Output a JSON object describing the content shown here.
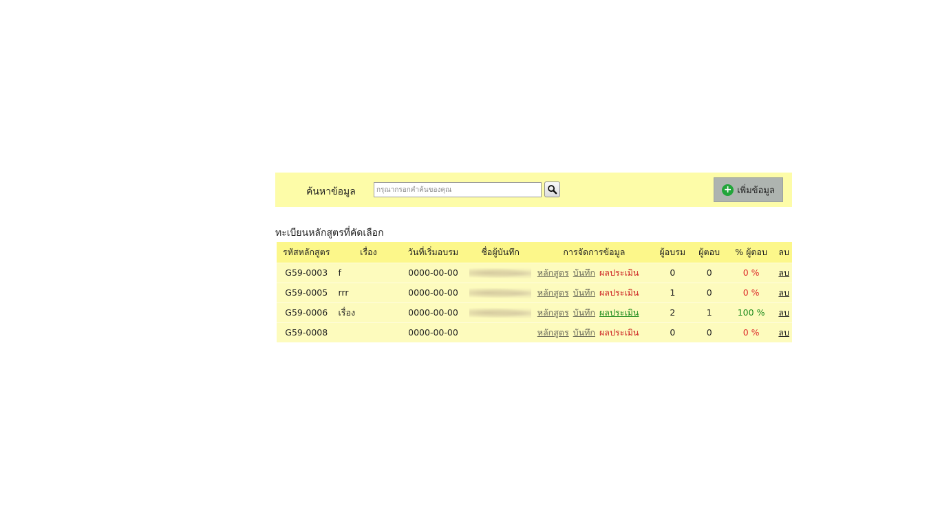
{
  "search": {
    "label": "ค้นหาข้อมูล",
    "placeholder": "กรุณากรอกคำค้นของคุณ",
    "value": ""
  },
  "add_button": {
    "label": "เพิ่มข้อมูล"
  },
  "section_title": "ทะเบียนหลักสูตรที่คัดเลือก",
  "table": {
    "headers": [
      "รหัสหลักสูตร",
      "เรื่อง",
      "วันที่เริ่มอบรม",
      "ชื่อผู้บันทึก",
      "การจัดการข้อมูล",
      "ผู้อบรม",
      "ผู้ตอบ",
      "% ผู้ตอบ",
      "ลบ"
    ],
    "actions": {
      "course": "หลักสูตร",
      "record": "บันทึก",
      "evaluate": "ผลประเมิน",
      "delete": "ลบ"
    },
    "rows": [
      {
        "code": "G59-0003",
        "subject": "f",
        "start_date": "0000-00-00",
        "trainees": "0",
        "responders": "0",
        "percent": "0 %"
      },
      {
        "code": "G59-0005",
        "subject": "rrr",
        "start_date": "0000-00-00",
        "trainees": "1",
        "responders": "0",
        "percent": "0 %"
      },
      {
        "code": "G59-0006",
        "subject": "เรื่อง",
        "start_date": "0000-00-00",
        "trainees": "2",
        "responders": "1",
        "percent": "100 %"
      },
      {
        "code": "G59-0008",
        "subject": "",
        "start_date": "0000-00-00",
        "trainees": "0",
        "responders": "0",
        "percent": "0 %"
      }
    ]
  },
  "colors": {
    "header_bg": "#fcf78a",
    "row_bg": "#fdfbbd",
    "bar_bg": "#fdfca8",
    "red": "#cc2222",
    "green": "#1c8a1c"
  },
  "icons": {
    "search": "magnifier-icon",
    "add": "plus-circle-icon"
  }
}
